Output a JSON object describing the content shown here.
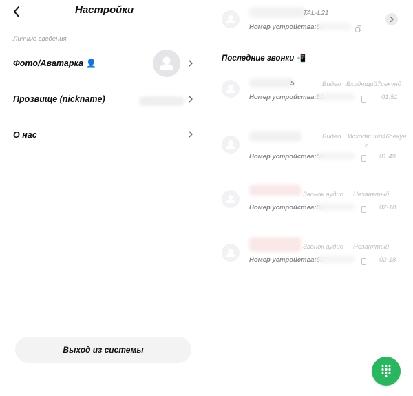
{
  "settings": {
    "title": "Настройки",
    "section_personal": "Личные сведения",
    "photo_label": "Фото/Аватарка",
    "photo_emoji": "👤",
    "nickname_label": "Прозвище (nickname)",
    "about_label": "О нас",
    "logout_label": "Выход из системы"
  },
  "device": {
    "model": "TAL-L21",
    "device_number_label": "Номер устройства:50"
  },
  "recent_calls": {
    "title": "Последние звонки",
    "title_emoji": "📲",
    "items": [
      {
        "number_suffix": "5",
        "type": "Видео",
        "direction": "Входящий7секунд",
        "device_label": "Номер устройства:50",
        "time": "01:51"
      },
      {
        "number_suffix": "",
        "type": "Видео",
        "direction": "Исходящий46секун",
        "direction_wrap": "д",
        "device_label": "Номер устройства:50",
        "time": "01:49"
      },
      {
        "number_suffix": "",
        "type": "Звонок аудио",
        "direction": "Незанятый",
        "device_label": "Номер устройства:50",
        "time": "02-18"
      },
      {
        "number_suffix": "",
        "type": "Звонок аудио",
        "direction": "Незанятый",
        "device_label": "Номер устройства:50",
        "time": "02-18"
      }
    ]
  },
  "icons": {
    "back": "back-arrow-icon",
    "chevron": "chevron-right-icon",
    "avatar": "person-avatar-icon",
    "copy": "copy-icon",
    "phone": "phone-device-icon",
    "dialpad": "dialpad-icon"
  },
  "colors": {
    "accent_green": "#2ab55f",
    "avatar_bg": "#e5e5e9",
    "button_bg": "#f3f3f3",
    "muted_text": "#9a9a9a"
  }
}
